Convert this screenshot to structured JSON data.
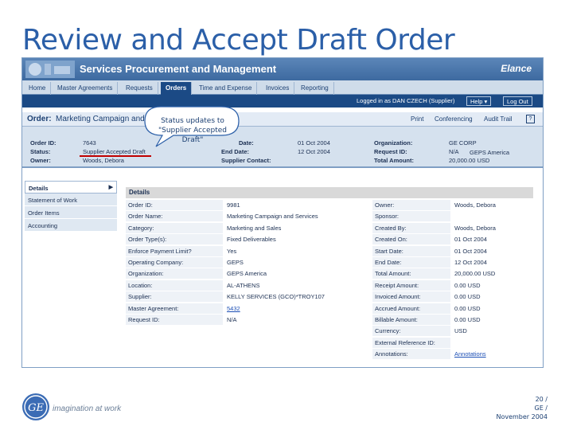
{
  "slide": {
    "title": "Review and Accept Draft Order",
    "tagline": "imagination at work",
    "footer": {
      "page": "20 /",
      "company": "GE /",
      "date": "November 2004"
    }
  },
  "app": {
    "title": "Services Procurement and Management",
    "vendor": "Elance",
    "nav": [
      "Home",
      "Master Agreements",
      "Requests",
      "Orders",
      "Time and Expense",
      "Invoices",
      "Reporting"
    ],
    "active_tab": "Orders",
    "logged_in": "Logged in as DAN CZECH (Supplier)",
    "help_label": "Help",
    "logout_label": "Log Out",
    "brand_color": "#1b4a85"
  },
  "order": {
    "label": "Order:",
    "name": "Marketing Campaign and",
    "actions": [
      "Print",
      "Conferencing",
      "Audit Trail"
    ],
    "help": "?"
  },
  "summary": {
    "order_id_label": "Order ID:",
    "order_id": "7643",
    "status_label": "Status:",
    "status": "Supplier Accepted Draft",
    "owner_label": "Owner:",
    "owner": "Woods, Debora",
    "start_date_label": "Date:",
    "start_date": "01 Oct 2004",
    "end_date_label": "End Date:",
    "end_date": "12 Oct 2004",
    "supplier_contact_label": "Supplier Contact:",
    "organization_label": "Organization:",
    "organization": "GE CORP",
    "request_id_label": "Request ID:",
    "request_id": "N/A",
    "request_org": "GEPS America",
    "total_label": "Total Amount:",
    "total": "20,000.00 USD"
  },
  "callout": {
    "text": "Status updates to \"Supplier Accepted Draft\""
  },
  "sidebar": [
    "Details",
    "Statement of Work",
    "Order Items",
    "Accounting"
  ],
  "details": {
    "header": "Details",
    "left": [
      [
        "Order ID:",
        "9981"
      ],
      [
        "Order Name:",
        "Marketing Campaign and Services"
      ],
      [
        "Category:",
        "Marketing and Sales"
      ],
      [
        "Order Type(s):",
        "Fixed Deliverables"
      ],
      [
        "Enforce Payment Limit?",
        "Yes"
      ],
      [
        "Operating Company:",
        "GEPS"
      ],
      [
        "Organization:",
        "GEPS America"
      ],
      [
        "Location:",
        "AL-ATHENS"
      ],
      [
        "Supplier:",
        "KELLY SERVICES (GCO)*TROY107"
      ],
      [
        "Master Agreement:",
        "5432"
      ],
      [
        "Request ID:",
        "N/A"
      ]
    ],
    "right": [
      [
        "Owner:",
        "Woods, Debora"
      ],
      [
        "Sponsor:",
        ""
      ],
      [
        "Created By:",
        "Woods, Debora"
      ],
      [
        "Created On:",
        "01 Oct 2004"
      ],
      [
        "Start Date:",
        "01 Oct 2004"
      ],
      [
        "End Date:",
        "12 Oct 2004"
      ],
      [
        "Total Amount:",
        "20,000.00 USD"
      ],
      [
        "Receipt Amount:",
        "0.00 USD"
      ],
      [
        "Invoiced Amount:",
        "0.00 USD"
      ],
      [
        "Accrued Amount:",
        "0.00 USD"
      ],
      [
        "Billable Amount:",
        "0.00 USD"
      ],
      [
        "Currency:",
        "USD"
      ],
      [
        "External Reference ID:",
        ""
      ],
      [
        "Annotations:",
        "Annotations"
      ]
    ]
  }
}
